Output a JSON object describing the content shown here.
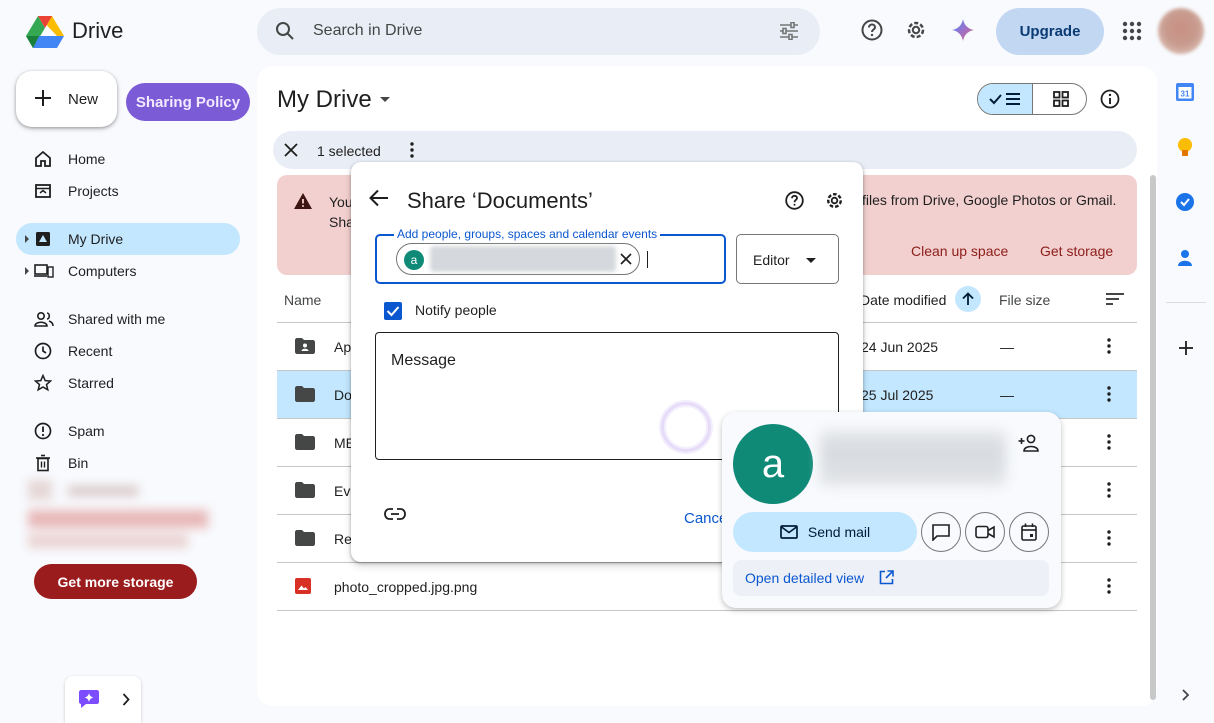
{
  "header": {
    "app_title": "Drive",
    "search_placeholder": "Search in Drive",
    "upgrade_label": "Upgrade",
    "icons": [
      "search-icon",
      "tune-icon",
      "help-icon",
      "settings-icon",
      "gemini-icon",
      "apps-icon"
    ]
  },
  "sidebar": {
    "new_label": "New",
    "sharing_policy_label": "Sharing Policy",
    "items": [
      {
        "label": "Home",
        "icon": "home-icon"
      },
      {
        "label": "Projects",
        "icon": "projects-icon"
      },
      {
        "label": "My Drive",
        "icon": "my-drive-icon",
        "active": true
      },
      {
        "label": "Computers",
        "icon": "computers-icon"
      },
      {
        "label": "Shared with me",
        "icon": "shared-icon"
      },
      {
        "label": "Recent",
        "icon": "clock-icon"
      },
      {
        "label": "Starred",
        "icon": "star-icon"
      },
      {
        "label": "Spam",
        "icon": "spam-icon"
      },
      {
        "label": "Bin",
        "icon": "trash-icon"
      }
    ],
    "get_more_storage_label": "Get more storage"
  },
  "main": {
    "title": "My Drive",
    "selection": {
      "text": "1 selected"
    },
    "banner": {
      "left_text_line1": "You",
      "left_text_line2": "Sha",
      "right_text": "files from Drive, Google Photos or Gmail.",
      "clean_up_label": "Clean up space",
      "get_storage_label": "Get storage"
    },
    "columns": {
      "name": "Name",
      "date_modified": "Date modified",
      "file_size": "File size"
    },
    "rows": [
      {
        "name": "Ap",
        "date": "24 Jun 2025",
        "size": "—",
        "icon": "shared-folder-icon",
        "selected": false
      },
      {
        "name": "Do",
        "date": "25 Jul 2025",
        "size": "—",
        "icon": "folder-icon",
        "selected": true
      },
      {
        "name": "ME",
        "date": "",
        "size": "",
        "icon": "folder-icon",
        "selected": false
      },
      {
        "name": "Eva",
        "date": "",
        "size": "",
        "icon": "folder-icon",
        "selected": false
      },
      {
        "name": "Re",
        "date": "",
        "size": "",
        "icon": "folder-icon",
        "selected": false
      },
      {
        "name": "photo_cropped.jpg.png",
        "date": "",
        "size": "",
        "icon": "image-icon",
        "selected": false
      }
    ]
  },
  "share_dialog": {
    "title": "Share ‘Documents’",
    "input_label": "Add people, groups, spaces and calendar events",
    "chip_avatar_letter": "a",
    "role_label": "Editor",
    "notify_label": "Notify people",
    "notify_checked": true,
    "message_placeholder": "Message",
    "cancel_label": "Cancel"
  },
  "hover_card": {
    "avatar_letter": "a",
    "send_mail_label": "Send mail",
    "open_detailed_view_label": "Open detailed view"
  },
  "colors": {
    "accent": "#0b57d0",
    "selected_bg": "#c2e7ff",
    "sharing_policy": "#7c5bd6",
    "banner_bg": "#f2d0cf",
    "avatar_teal": "#0f8a77",
    "get_more_storage": "#9b1c1c"
  }
}
